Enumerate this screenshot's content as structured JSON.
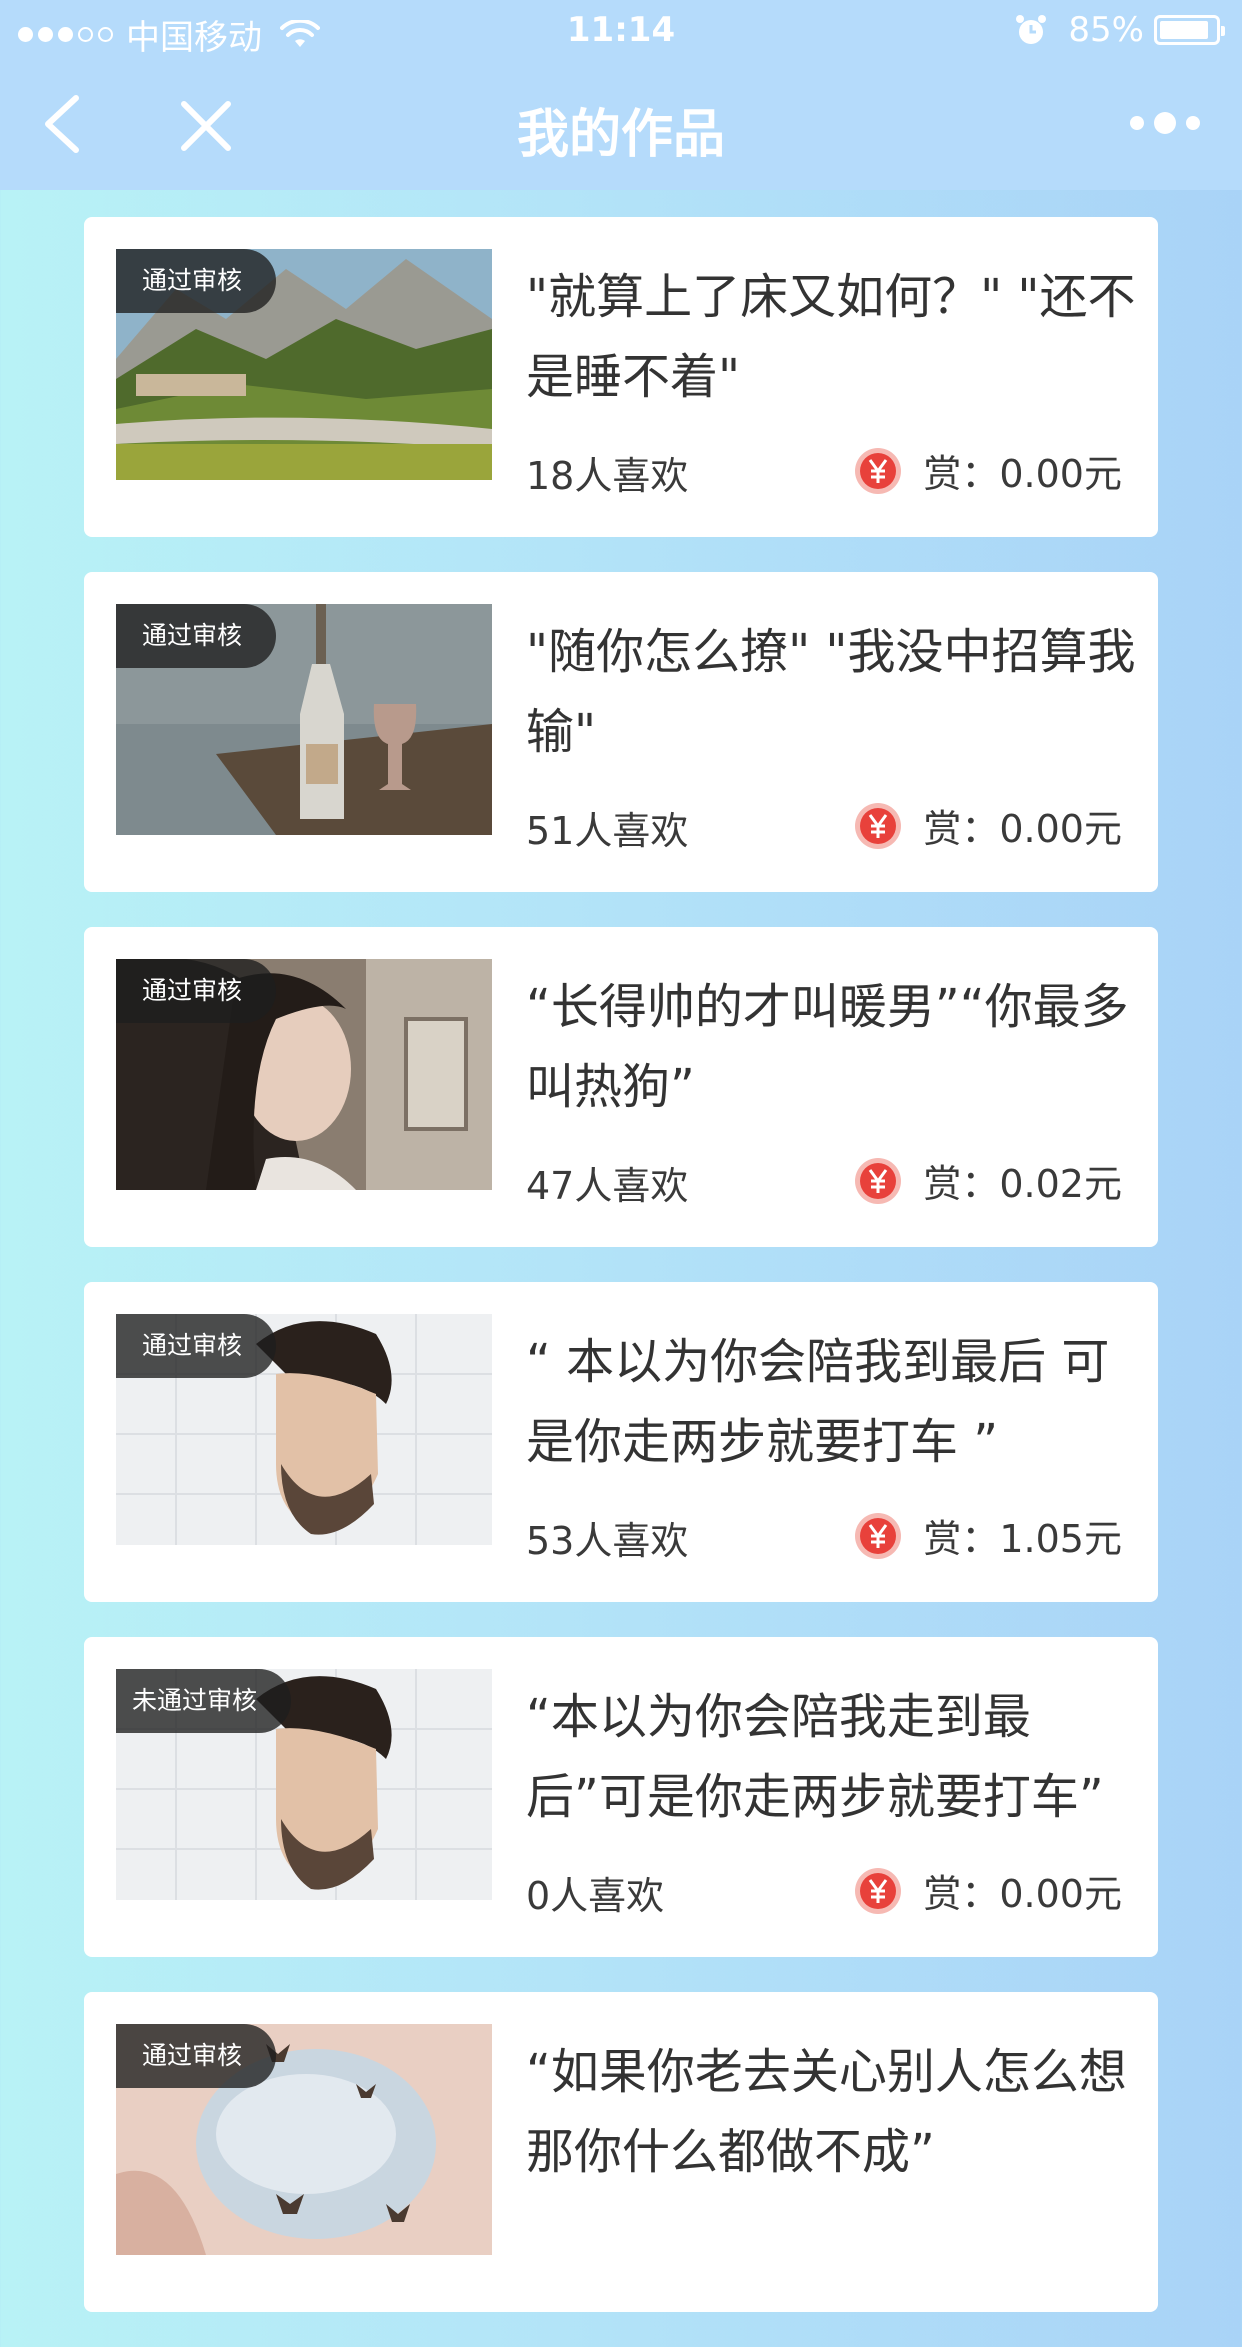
{
  "status_bar": {
    "carrier": "中国移动",
    "time": "11:14",
    "battery": "85%",
    "battery_level": 0.85
  },
  "nav": {
    "title": "我的作品",
    "back_icon": "chevron-left-icon",
    "close_icon": "close-icon",
    "more_icon": "more-icon"
  },
  "works": [
    {
      "badge": "通过审核",
      "title": "\"就算上了床又如何？\" \"还不是睡不着\"",
      "likes": "18人喜欢",
      "reward": "赏：0.00元",
      "image": "mountain-village"
    },
    {
      "badge": "通过审核",
      "title": "\"随你怎么撩\" \"我没中招算我输\"",
      "likes": "51人喜欢",
      "reward": "赏：0.00元",
      "image": "wine-bottle"
    },
    {
      "badge": "通过审核",
      "title": "“长得帅的才叫暖男”“你最多叫热狗”",
      "likes": "47人喜欢",
      "reward": "赏：0.02元",
      "image": "woman-portrait"
    },
    {
      "badge": "通过审核",
      "title": "“ 本以为你会陪我到最后 可是你走两步就要打车 ”",
      "likes": "53人喜欢",
      "reward": "赏：1.05元",
      "image": "man-portrait"
    },
    {
      "badge": "未通过审核",
      "title": "“本以为你会陪我走到最后”可是你走两步就要打车”",
      "likes": "0人喜欢",
      "reward": "赏：0.00元",
      "image": "man-portrait"
    },
    {
      "badge": "通过审核",
      "title": "“如果你老去关心别人怎么想 那你什么都做不成”",
      "likes": "",
      "reward": "",
      "image": "butterflies"
    }
  ],
  "colors": {
    "nav_bg": "#b5dbfb",
    "card_bg": "#ffffff",
    "yen_red": "#e8413b"
  }
}
